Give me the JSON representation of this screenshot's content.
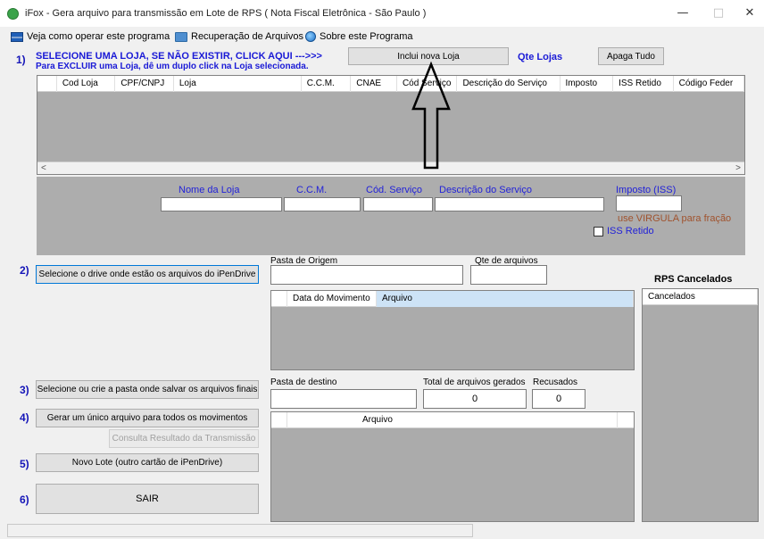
{
  "window": {
    "title": "iFox - Gera arquivo para transmissão em Lote de RPS ( Nota Fiscal Eletrônica - São Paulo )",
    "minimize": "—",
    "maximize": "□",
    "close": "✕"
  },
  "menu": {
    "help": "Veja como operar este programa",
    "recover": "Recuperação de Arquivos",
    "about": "Sobre este Programa"
  },
  "steps": {
    "s1": "1)",
    "s2": "2)",
    "s3": "3)",
    "s4": "4)",
    "s5": "5)",
    "s6": "6)"
  },
  "section1": {
    "line1": "SELECIONE UMA LOJA, SE NÃO EXISTIR, CLICK AQUI --->>>",
    "line2": "Para EXCLUIR uma Loja, dê um duplo click na Loja selecionada.",
    "include_button": "Inclui nova Loja",
    "qte_lojas": "Qte Lojas",
    "clear_button": "Apaga Tudo",
    "columns": [
      "Cod Loja",
      "CPF/CNPJ",
      "Loja",
      "C.C.M.",
      "CNAE",
      "Cód Serviço",
      "Descrição do Serviço",
      "Imposto",
      "ISS Retido",
      "Código Feder"
    ],
    "scroll_left": "<",
    "scroll_right": ">"
  },
  "store_form": {
    "nome_loja": "Nome da Loja",
    "ccm": "C.C.M.",
    "cod_servico": "Cód. Serviço",
    "descricao": "Descrição do Serviço",
    "imposto": "Imposto (ISS)",
    "virgula_hint": "use VIRGULA para fração",
    "iss_retido": "ISS Retido"
  },
  "section2": {
    "select_drive_button": "Selecione o drive onde estão os arquivos do iPenDrive",
    "pasta_origem": "Pasta de Origem",
    "qte_arquivos": "Qte de arquivos",
    "columns": [
      "Data do Movimento",
      "Arquivo"
    ]
  },
  "cancelados": {
    "title": "RPS Cancelados",
    "column": "Cancelados"
  },
  "section3": {
    "select_folder_button": "Selecione ou crie a pasta onde salvar os arquivos finais",
    "pasta_destino": "Pasta de destino",
    "total_gerados": "Total de arquivos gerados",
    "total_value": "0",
    "recusados": "Recusados",
    "recusados_value": "0"
  },
  "section4": {
    "generate_button": "Gerar um único arquivo para todos os movimentos",
    "consult_button": "Consulta Resultado da Transmissão",
    "column": "Arquivo"
  },
  "section5": {
    "new_batch_button": "Novo Lote (outro cartão de iPenDrive)"
  },
  "section6": {
    "exit_button": "SAIR"
  }
}
